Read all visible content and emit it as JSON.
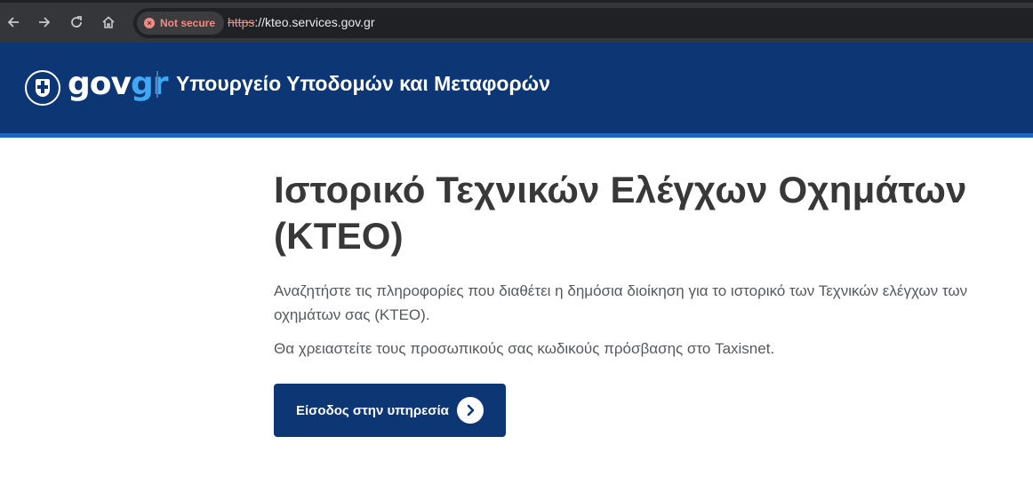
{
  "browser": {
    "security_label": "Not secure",
    "url_scheme": "https",
    "url_rest": "://kteo.services.gov.gr"
  },
  "header": {
    "logo_gov": "gov",
    "logo_gr": "gr",
    "ministry": "Υπουργείο Υποδομών και Μεταφορών",
    "colors": {
      "background": "#0d3774",
      "stripe": "#1e64c8",
      "logo_gr": "#3fa9f5"
    }
  },
  "main": {
    "title": "Ιστορικό Τεχνικών Ελέγχων Οχημάτων (ΚΤΕΟ)",
    "description": "Αναζητήστε τις πληροφορίες που διαθέτει η δημόσια διοίκηση για το ιστορικό των Τεχνικών ελέγχων των οχημάτων σας (ΚΤΕΟ).",
    "note": "Θα χρειαστείτε τους προσωπικούς σας κωδικούς πρόσβασης στο Taxisnet.",
    "start_button": "Είσοδος στην υπηρεσία"
  },
  "icons": [
    "back-arrow-icon",
    "forward-arrow-icon",
    "reload-icon",
    "home-icon",
    "not-secure-icon",
    "emblem-icon",
    "chevron-right-icon"
  ]
}
